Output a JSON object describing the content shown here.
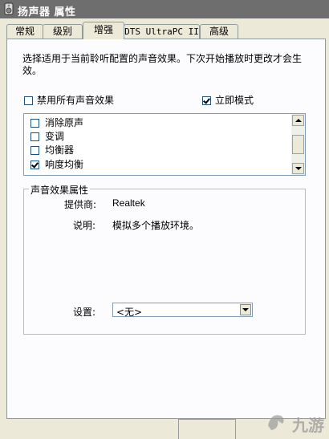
{
  "window": {
    "title": "扬声器 属性"
  },
  "tabs": [
    {
      "label": "常规"
    },
    {
      "label": "级别"
    },
    {
      "label": "增强"
    },
    {
      "label": "DTS UltraPC II"
    },
    {
      "label": "高级"
    }
  ],
  "enhancements": {
    "description": "选择适用于当前聆听配置的声音效果。下次开始播放时更改才会生效。",
    "disable_all_label": "禁用所有声音效果",
    "disable_all_checked": false,
    "immediate_mode_label": "立即模式",
    "immediate_mode_checked": true,
    "effects": [
      {
        "label": "消除原声",
        "checked": false
      },
      {
        "label": "变调",
        "checked": false
      },
      {
        "label": "均衡器",
        "checked": false
      },
      {
        "label": "响度均衡",
        "checked": true
      }
    ]
  },
  "properties": {
    "group_title": "声音效果属性",
    "provider_label": "提供商:",
    "provider_value": "Realtek",
    "description_label": "说明:",
    "description_value": "模拟多个播放环境。",
    "setting_label": "设置:",
    "setting_value": "<无>"
  },
  "watermark": {
    "text": "九游"
  }
}
